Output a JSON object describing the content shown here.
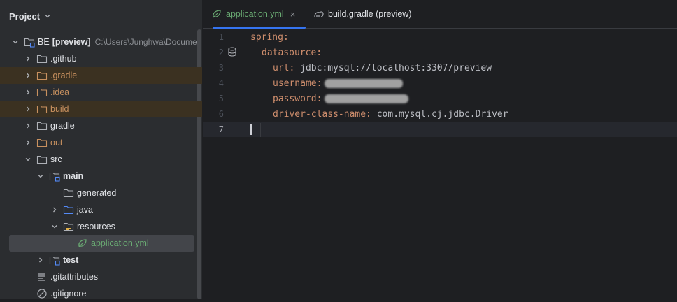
{
  "sidebar": {
    "title": "Project",
    "tree": [
      {
        "label": "BE",
        "bold_suffix": "[preview]",
        "path": "C:\\Users\\Junghwa\\Docume",
        "color": "normal",
        "expanded": true
      },
      {
        "label": ".github",
        "color": "normal",
        "expanded": false
      },
      {
        "label": ".gradle",
        "color": "orange",
        "expanded": false
      },
      {
        "label": ".idea",
        "color": "orange",
        "expanded": false
      },
      {
        "label": "build",
        "color": "orange",
        "expanded": false
      },
      {
        "label": "gradle",
        "color": "normal",
        "expanded": false
      },
      {
        "label": "out",
        "color": "orange",
        "expanded": false
      },
      {
        "label": "src",
        "color": "normal",
        "expanded": true
      },
      {
        "label": "main",
        "color": "normal",
        "expanded": true
      },
      {
        "label": "generated",
        "color": "normal"
      },
      {
        "label": "java",
        "color": "normal",
        "expanded": false
      },
      {
        "label": "resources",
        "color": "normal",
        "expanded": true
      },
      {
        "label": "application.yml",
        "color": "green"
      },
      {
        "label": "test",
        "color": "normal",
        "expanded": false
      },
      {
        "label": ".gitattributes",
        "color": "normal"
      },
      {
        "label": ".gitignore",
        "color": "normal"
      }
    ]
  },
  "tabs": [
    {
      "label": "application.yml",
      "active": true,
      "close": "×"
    },
    {
      "label": "build.gradle (preview)",
      "active": false
    }
  ],
  "editor": {
    "line_numbers": [
      "1",
      "2",
      "3",
      "4",
      "5",
      "6",
      "7"
    ],
    "lines": [
      {
        "key": "spring:",
        "value": ""
      },
      {
        "key": "datasource:",
        "value": ""
      },
      {
        "key": "url:",
        "value": " jdbc:mysql://localhost:3307/preview"
      },
      {
        "key": "username:",
        "value": ""
      },
      {
        "key": "password:",
        "value": ""
      },
      {
        "key": "driver-class-name:",
        "value": " com.mysql.cj.jdbc.Driver"
      },
      {
        "key": "",
        "value": ""
      }
    ]
  },
  "colors": {
    "accent": "#3574f0",
    "yaml_key": "#cf8e6d",
    "excluded_folder": "#c9915f",
    "yml_file": "#6aab73"
  }
}
